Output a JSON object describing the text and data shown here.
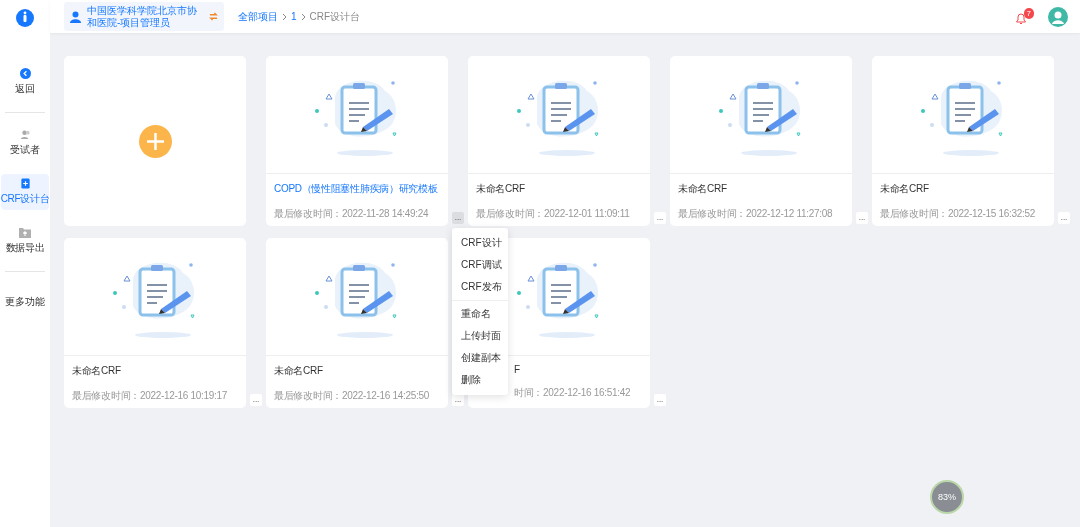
{
  "sidebar": {
    "back": {
      "label": "返回"
    },
    "items": [
      {
        "label": "受试者",
        "selected": false
      },
      {
        "label": "CRF设计台",
        "selected": true
      },
      {
        "label": "数据导出",
        "selected": false
      }
    ],
    "more": {
      "label": "更多功能"
    }
  },
  "header": {
    "organization": "中国医学科学院北京市协和医院-项目管理员",
    "breadcrumb": [
      "全部项目",
      "1",
      "CRF设计台"
    ],
    "notifications": "7"
  },
  "cards": [
    {
      "kind": "add"
    },
    {
      "kind": "crf",
      "title": "COPD（慢性阻塞性肺疾病）研究模板",
      "highlighted": true,
      "modified": "最后修改时间：2022-11-28 14:49:24",
      "menu_open": true,
      "partly_covered": false
    },
    {
      "kind": "crf",
      "title": "未命名CRF",
      "highlighted": false,
      "modified": "最后修改时间：2022-12-01 11:09:11",
      "menu_open": false,
      "partly_covered": false
    },
    {
      "kind": "crf",
      "title": "未命名CRF",
      "highlighted": false,
      "modified": "最后修改时间：2022-12-12 11:27:08",
      "menu_open": false,
      "partly_covered": false
    },
    {
      "kind": "crf",
      "title": "未命名CRF",
      "highlighted": false,
      "modified": "最后修改时间：2022-12-15 16:32:52",
      "menu_open": false,
      "partly_covered": false
    },
    {
      "kind": "crf",
      "title": "未命名CRF",
      "highlighted": false,
      "modified": "最后修改时间：2022-12-16 10:19:17",
      "menu_open": false,
      "partly_covered": false
    },
    {
      "kind": "crf",
      "title": "未命名CRF",
      "highlighted": false,
      "modified": "最后修改时间：2022-12-16 14:25:50",
      "menu_open": false,
      "partly_covered": false
    },
    {
      "kind": "crf",
      "title": "F",
      "highlighted": false,
      "modified": "时间：2022-12-16 16:51:42",
      "menu_open": false,
      "partly_covered": true
    }
  ],
  "card_menu": [
    [
      "CRF设计",
      "CRF调试",
      "CRF发布"
    ],
    [
      "重命名",
      "上传封面",
      "创建副本",
      "删除"
    ]
  ],
  "dots_label": "...",
  "gauge": {
    "reading": "83%"
  }
}
